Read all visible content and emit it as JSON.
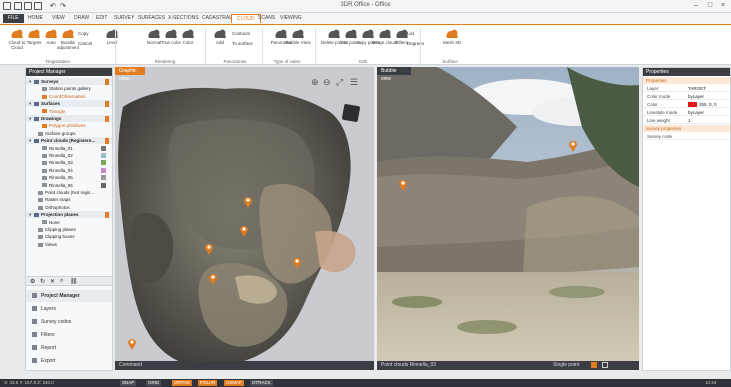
{
  "window": {
    "title": "3DR Office - Office",
    "min": "–",
    "max": "□",
    "close": "×"
  },
  "menu": [
    {
      "label": "FILE",
      "state": "file"
    },
    {
      "label": "HOME",
      "state": ""
    },
    {
      "label": "VIEW",
      "state": ""
    },
    {
      "label": "DRAW",
      "state": ""
    },
    {
      "label": "EDIT",
      "state": ""
    },
    {
      "label": "SURVEY",
      "state": ""
    },
    {
      "label": "SURFACES",
      "state": ""
    },
    {
      "label": "X-SECTIONS",
      "state": ""
    },
    {
      "label": "CADASTRAL",
      "state": ""
    },
    {
      "label": "CLOUD",
      "state": "active"
    },
    {
      "label": "SCANS",
      "state": ""
    },
    {
      "label": "VIEWING",
      "state": ""
    }
  ],
  "ribbon": {
    "buttons": [
      {
        "name": "cloud-to-cloud",
        "label": "Cloud to Cloud",
        "color": "#e07d20"
      },
      {
        "name": "targets",
        "label": "Targets",
        "color": "#e07d20"
      },
      {
        "name": "auto",
        "label": "Auto",
        "color": "#e07d20"
      },
      {
        "name": "bundle-adjustment",
        "label": "Bundle adjustment",
        "color": "#e07d20"
      },
      {
        "name": "level",
        "label": "Level",
        "color": "#555"
      },
      {
        "name": "normal",
        "label": "Normal",
        "color": "#555"
      },
      {
        "name": "true-color",
        "label": "True color",
        "color": "#555"
      },
      {
        "name": "color",
        "label": "Color",
        "color": "#555"
      },
      {
        "name": "add",
        "label": "Add",
        "color": "#555"
      },
      {
        "name": "panorama",
        "label": "Panorama",
        "color": "#555"
      },
      {
        "name": "bubble-view",
        "label": "Bubble View",
        "color": "#555"
      },
      {
        "name": "delete-points",
        "label": "Delete points",
        "color": "#555"
      },
      {
        "name": "cut-points",
        "label": "Cut points",
        "color": "#555"
      },
      {
        "name": "copy-points",
        "label": "Copy points",
        "color": "#555"
      },
      {
        "name": "merge-clouds",
        "label": "Merge clouds",
        "color": "#555"
      },
      {
        "name": "filters",
        "label": "Filters",
        "color": "#555"
      },
      {
        "name": "mesh-3d",
        "label": "Mesh 3D",
        "color": "#e07d20"
      }
    ],
    "small": {
      "copy": "Copy",
      "cancel": "Cancel",
      "contours": "Contours",
      "to-surface": "To surface",
      "list": "List",
      "degrees": "Degrees",
      "cuts": "Cuts",
      "terrain": "Terrain"
    },
    "groups": [
      {
        "label": "Registration"
      },
      {
        "label": "Rendering"
      },
      {
        "label": "Panoramas"
      },
      {
        "label": "Type of video"
      },
      {
        "label": "Edit"
      },
      {
        "label": "Surface"
      }
    ]
  },
  "left_panel": {
    "title": "Project Manager",
    "tree": [
      {
        "label": "Surveys",
        "kind": "cat"
      },
      {
        "label": "Station points gallery",
        "kind": "item",
        "indent": 2
      },
      {
        "label": "CoordObservation",
        "kind": "sub",
        "indent": 2
      },
      {
        "label": "Surfaces",
        "kind": "cat"
      },
      {
        "label": "Triangle",
        "kind": "sub",
        "indent": 2
      },
      {
        "label": "Drawings",
        "kind": "cat"
      },
      {
        "label": "Polygon primitives",
        "kind": "sub",
        "indent": 2
      },
      {
        "label": "Surface groups",
        "kind": "item",
        "indent": 1
      },
      {
        "label": "Point clouds (Registere...",
        "kind": "cat"
      },
      {
        "label": "Rinnella_01",
        "kind": "item",
        "indent": 2
      },
      {
        "label": "Rinnella_02",
        "kind": "item",
        "indent": 2
      },
      {
        "label": "Rinnella_03",
        "kind": "item",
        "indent": 2
      },
      {
        "label": "Rinnella_04",
        "kind": "item",
        "indent": 2
      },
      {
        "label": "Rinnella_05",
        "kind": "item",
        "indent": 2
      },
      {
        "label": "Rinnella_06",
        "kind": "item",
        "indent": 2
      },
      {
        "label": "Point clouds (Not regis...",
        "kind": "item",
        "indent": 1
      },
      {
        "label": "Raster maps",
        "kind": "item",
        "indent": 1
      },
      {
        "label": "Orthophotos",
        "kind": "item",
        "indent": 1
      },
      {
        "label": "Projection planes",
        "kind": "cat"
      },
      {
        "label": "None",
        "kind": "item",
        "indent": 2
      },
      {
        "label": "Clipping planes",
        "kind": "item",
        "indent": 1
      },
      {
        "label": "Clipping boxes",
        "kind": "item",
        "indent": 1
      },
      {
        "label": "Views",
        "kind": "item",
        "indent": 1
      }
    ],
    "nav": [
      {
        "label": "Project Manager",
        "icon": "folder-icon"
      },
      {
        "label": "Layers",
        "icon": "layers-icon"
      },
      {
        "label": "Survey codes",
        "icon": "codes-icon"
      },
      {
        "label": "Filters",
        "icon": "filter-icon"
      },
      {
        "label": "Report",
        "icon": "report-icon"
      },
      {
        "label": "Export",
        "icon": "export-icon"
      }
    ]
  },
  "view3d": {
    "tab": "Graphic view",
    "bottom": "Command"
  },
  "viewpic": {
    "tab": "Bubble view",
    "bottom": "Point clouds  Rinnella_03",
    "single": "Single point"
  },
  "properties": {
    "title": "Properties",
    "section1": "Properties",
    "rows": [
      {
        "k": "Layer",
        "v": "TARGET"
      },
      {
        "k": "Color mode",
        "v": "byLayer"
      },
      {
        "k": "Color",
        "v": "255, 0, 0"
      },
      {
        "k": "Linestyle mode",
        "v": "byLayer"
      },
      {
        "k": "Line weight",
        "v": "1"
      }
    ],
    "section2": "Survey properties",
    "rows2": [
      {
        "k": "Survey code",
        "v": ""
      }
    ]
  },
  "status": {
    "coords": "X: 43.5 Y: 157.8 Z: 240.0",
    "chips": [
      "SNAP",
      "GRID",
      "ORTHO",
      "POLAR",
      "OSNAP",
      "OTRACK"
    ],
    "right": "10:44"
  },
  "colors": {
    "accent": "#e07d20",
    "dark": "#3a3d44"
  }
}
